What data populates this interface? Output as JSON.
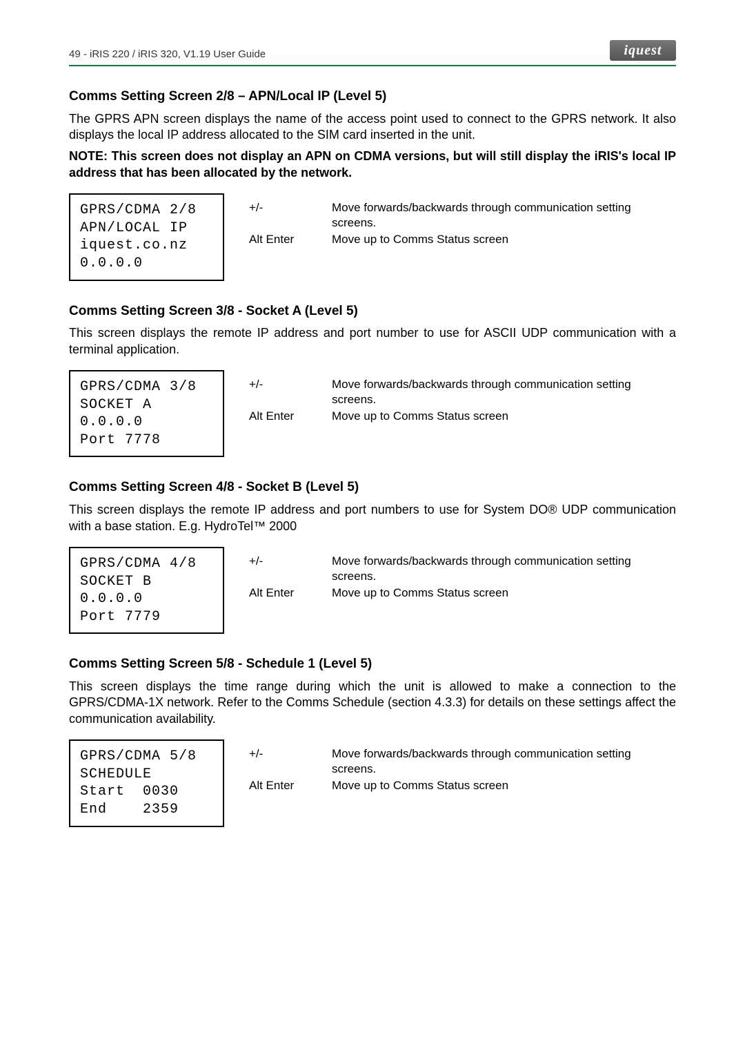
{
  "header": {
    "left": "49 - iRIS 220 / iRIS 320, V1.19 User Guide",
    "logo_text": "iquest"
  },
  "sections": [
    {
      "title": "Comms Setting Screen 2/8 – APN/Local IP (Level 5)",
      "body": "The GPRS APN screen displays the name of the access point used to connect to the GPRS network.  It also displays the local IP address allocated to the SIM card inserted in the unit.",
      "note": "NOTE: This screen does not display an APN on CDMA versions, but will still display the iRIS's local IP address that has been allocated by the network.",
      "lcd": "GPRS/CDMA 2/8\nAPN/LOCAL IP\niquest.co.nz\n0.0.0.0",
      "keys": [
        {
          "k": "+/-",
          "d": "Move forwards/backwards through communication setting screens."
        },
        {
          "k": "Alt Enter",
          "d": "Move up to Comms Status screen"
        }
      ]
    },
    {
      "title": "Comms Setting Screen 3/8 - Socket A (Level 5)",
      "body": "This screen displays the remote IP address and port number to use for ASCII UDP communication with a terminal application.",
      "lcd": "GPRS/CDMA 3/8\nSOCKET A\n0.0.0.0\nPort 7778",
      "keys": [
        {
          "k": "+/-",
          "d": "Move forwards/backwards through communication setting screens."
        },
        {
          "k": "Alt Enter",
          "d": "Move up to Comms Status screen"
        }
      ]
    },
    {
      "title": "Comms Setting Screen 4/8 - Socket B (Level 5)",
      "body": "This screen displays the remote IP address and port numbers to use for System DO® UDP communication with a base station. E.g. HydroTel™ 2000",
      "lcd": "GPRS/CDMA 4/8\nSOCKET B\n0.0.0.0\nPort 7779",
      "keys": [
        {
          "k": "+/-",
          "d": "Move forwards/backwards through communication setting screens."
        },
        {
          "k": "Alt Enter",
          "d": "Move up to Comms Status screen"
        }
      ]
    },
    {
      "title": "Comms Setting Screen 5/8 - Schedule 1 (Level 5)",
      "body": "This screen displays the time range during which the unit is allowed to make a connection to the GPRS/CDMA-1X network.  Refer to the Comms Schedule (section 4.3.3) for details on these settings affect the communication availability.",
      "lcd": "GPRS/CDMA 5/8\nSCHEDULE\nStart  0030\nEnd    2359",
      "keys": [
        {
          "k": "+/-",
          "d": "Move forwards/backwards through communication setting screens."
        },
        {
          "k": "Alt Enter",
          "d": "Move up to Comms Status screen"
        }
      ]
    }
  ]
}
